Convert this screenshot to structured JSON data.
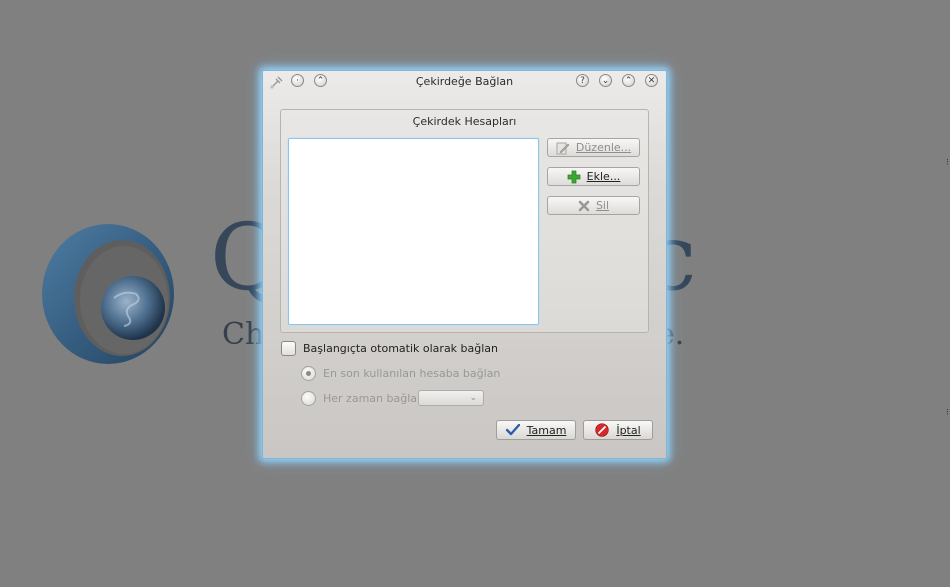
{
  "background": {
    "logo_text_large_left": "Q",
    "logo_text_large_right": "c",
    "logo_text_small_left": "Ch",
    "logo_text_small_right": "e."
  },
  "dialog": {
    "title": "Çekirdeğe Bağlan",
    "titlebar_left_buttons": [
      "app-icon",
      "minimize-dot-icon",
      "keep-above-icon"
    ],
    "titlebar_right_buttons": [
      "help-icon",
      "shade-icon",
      "maximize-icon",
      "close-icon"
    ],
    "group_title": "Çekirdek Hesapları",
    "accounts": [],
    "buttons": {
      "edit": "Düzenle...",
      "add": "Ekle...",
      "remove": "Sil",
      "ok": "Tamam",
      "cancel": "İptal"
    },
    "auto_connect": {
      "label": "Başlangıçta otomatik olarak bağlan",
      "checked": false
    },
    "options": {
      "last_used": "En son kullanılan hesaba bağlan",
      "last_used_selected": true,
      "always": "Her zaman bağlan",
      "always_selected": false,
      "always_combo_value": ""
    }
  },
  "colors": {
    "desktop_bg": "#808080",
    "focus_glow": "#8ec3ea",
    "add_icon": "#3aa832",
    "ok_icon": "#2b5ea8",
    "cancel_icon": "#d52a2a"
  }
}
